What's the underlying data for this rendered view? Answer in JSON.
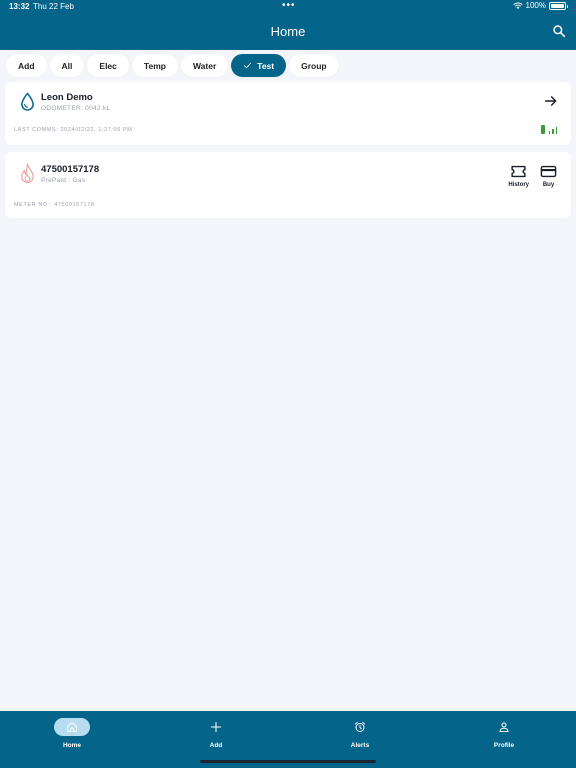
{
  "status": {
    "time": "13:32",
    "date": "Thu 22 Feb",
    "battery": "100%",
    "battery_level": 1.0
  },
  "header": {
    "title": "Home"
  },
  "filters": [
    {
      "label": "Add",
      "active": false
    },
    {
      "label": "All",
      "active": false
    },
    {
      "label": "Elec",
      "active": false
    },
    {
      "label": "Temp",
      "active": false
    },
    {
      "label": "Water",
      "active": false
    },
    {
      "label": "Test",
      "active": true
    },
    {
      "label": "Group",
      "active": false
    }
  ],
  "cards": [
    {
      "title": "Leon Demo",
      "subtitle": "ODOMETER: 0042 kL",
      "footer": "LAST COMMS: 2024/02/22, 1:27:06 PM",
      "icon": "water-drop-icon"
    },
    {
      "title": "47500157178",
      "subtitle": "PrePaid : Gas",
      "footer": "METER NO : 47500157178",
      "icon": "gas-flame-icon",
      "actions": [
        {
          "label": "History",
          "icon": "ticket-icon"
        },
        {
          "label": "Buy",
          "icon": "credit-card-icon"
        }
      ]
    }
  ],
  "nav": [
    {
      "label": "Home",
      "icon": "home-icon",
      "selected": true
    },
    {
      "label": "Add",
      "icon": "plus-icon",
      "selected": false
    },
    {
      "label": "Alerts",
      "icon": "alarm-clock-icon",
      "selected": false
    },
    {
      "label": "Profile",
      "icon": "person-icon",
      "selected": false
    }
  ],
  "colors": {
    "brand": "#05648a",
    "background": "#f4f5fa",
    "signal": "#3b9b3b",
    "gas": "#e8a7a7",
    "water": "#1a6c95"
  }
}
